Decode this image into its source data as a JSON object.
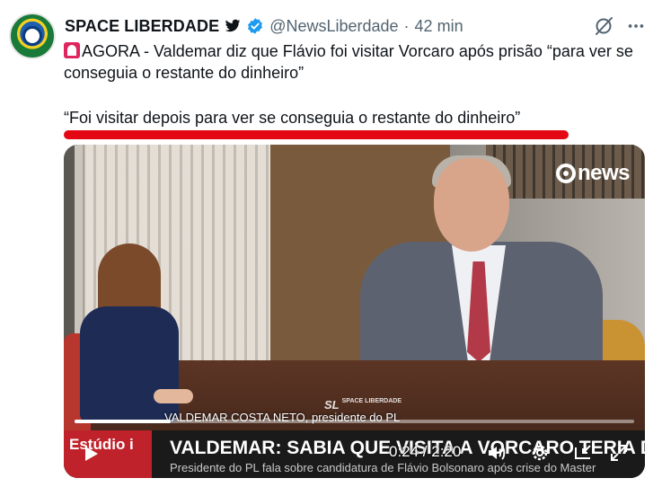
{
  "post": {
    "author_name": "SPACE LIBERDADE",
    "handle": "@NewsLiberdade",
    "separator": "·",
    "time_ago": "42 min",
    "text_line": "AGORA - Valdemar diz que Flávio foi visitar Vorcaro após prisão “para ver se conseguia o restante do dinheiro”",
    "quote": "“Foi visitar depois para ver se conseguia o restante do dinheiro”",
    "accent_color": "#e30613"
  },
  "video": {
    "channel_logo": "news",
    "watermark_main": "SL",
    "watermark_sub": "SPACE LIBERDADE",
    "caption": "VALDEMAR COSTA NETO, presidente do PL",
    "studio_tag": "Estúdio i",
    "headline": "VALDEMAR: SABIA QUE VISITA A VORCARO TERIA DESGASTE ELEITORAL",
    "subheadline": "Presidente do PL fala sobre candidatura de Flávio Bolsonaro após crise do Master",
    "time_display": "0:24 / 2:20",
    "progress_fraction": 0.171,
    "controls": [
      "play-icon",
      "volume-icon",
      "settings-icon",
      "pip-icon",
      "fullscreen-icon"
    ]
  },
  "icons": {
    "bird": "bird-icon",
    "verified": "verified-badge-icon",
    "grok": "grok-icon",
    "more": "more-icon"
  }
}
